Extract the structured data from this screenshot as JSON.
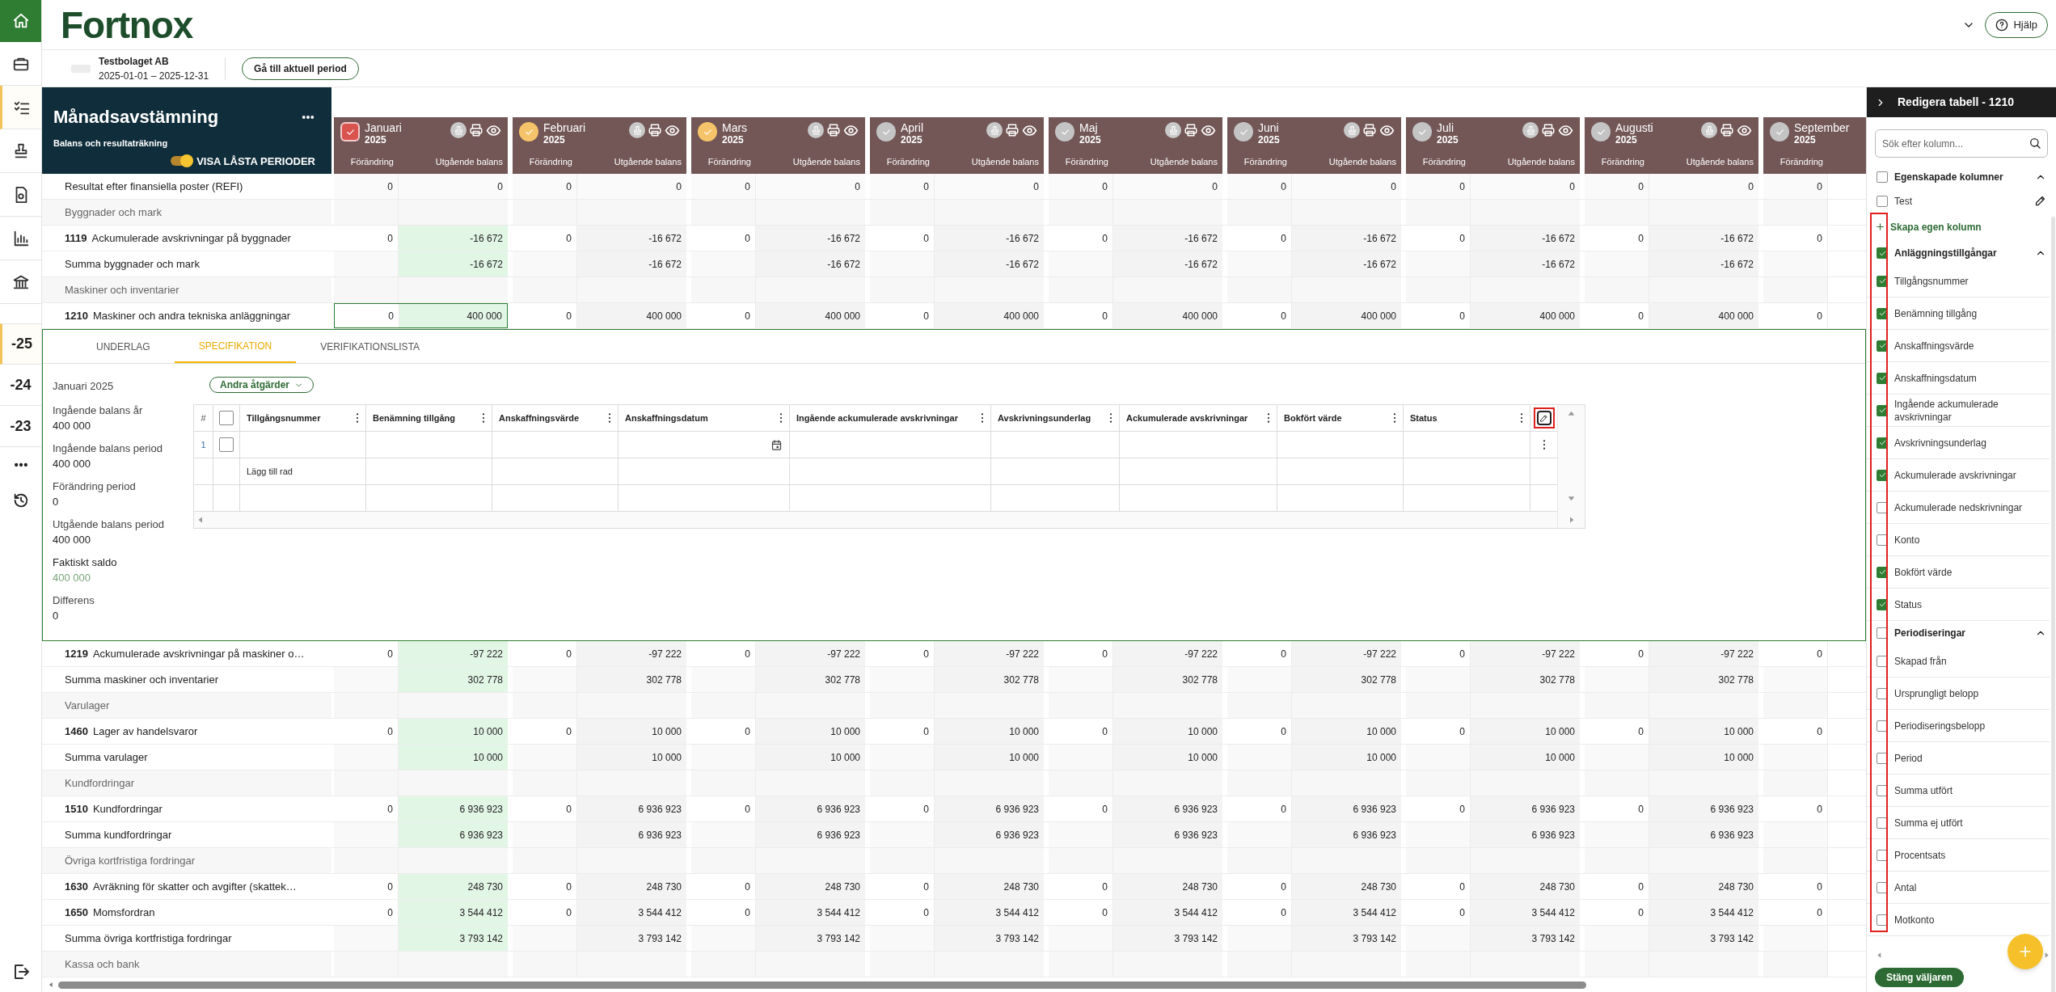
{
  "top_bar": {
    "logo": "Fortnox",
    "help_button": "Hjälp"
  },
  "company_bar": {
    "name": "Testbolaget AB",
    "period": "2025-01-01 – 2025-12-31",
    "button": "Gå till aktuell period"
  },
  "nav": {
    "icons": [
      {
        "selected": false
      },
      {
        "selected": false
      },
      {
        "selected": true
      },
      {
        "selected": false
      },
      {
        "selected": false
      },
      {
        "selected": false
      },
      {
        "selected": false
      }
    ],
    "years": [
      {
        "label": "-25",
        "selected": true
      },
      {
        "label": "-24",
        "selected": false
      },
      {
        "label": "-23",
        "selected": false
      }
    ]
  },
  "page_header": {
    "title": "Månadsavstämning",
    "subtitle": "Balans och resultaträkning",
    "toggle": {
      "label": "VISA LÅSTA PERIODER",
      "on": true
    }
  },
  "months": [
    {
      "name": "Januari",
      "year": "2025",
      "color": "#d9534f",
      "selected": true,
      "columns": [
        "Förändring",
        "Utgående balans"
      ]
    },
    {
      "name": "Februari",
      "year": "2025",
      "color": "#f5c46a",
      "selected": false,
      "columns": [
        "Förändring",
        "Utgående balans"
      ]
    },
    {
      "name": "Mars",
      "year": "2025",
      "color": "#f5c46a",
      "selected": false,
      "columns": [
        "Förändring",
        "Utgående balans"
      ]
    },
    {
      "name": "April",
      "year": "2025",
      "color": "#c4c4c4",
      "selected": false,
      "columns": [
        "Förändring",
        "Utgående balans"
      ]
    },
    {
      "name": "Maj",
      "year": "2025",
      "color": "#c4c4c4",
      "selected": false,
      "columns": [
        "Förändring",
        "Utgående balans"
      ]
    },
    {
      "name": "Juni",
      "year": "2025",
      "color": "#c4c4c4",
      "selected": false,
      "columns": [
        "Förändring",
        "Utgående balans"
      ]
    },
    {
      "name": "Juli",
      "year": "2025",
      "color": "#c4c4c4",
      "selected": false,
      "columns": [
        "Förändring",
        "Utgående balans"
      ]
    },
    {
      "name": "Augusti",
      "year": "2025",
      "color": "#c4c4c4",
      "selected": false,
      "columns": [
        "Förändring",
        "Utgående balans"
      ]
    },
    {
      "name": "September",
      "year": "2025",
      "color": "#c4c4c4",
      "selected": false,
      "columns": [
        "Förändring"
      ]
    }
  ],
  "rows": [
    {
      "kind": "result",
      "label": "Resultat efter finansiella poster (REFI)",
      "expanded": false,
      "change": [
        "0",
        "0",
        "0",
        "0",
        "0",
        "0",
        "0",
        "0",
        "0"
      ],
      "balance": [
        "0",
        "0",
        "0",
        "0",
        "0",
        "0",
        "0",
        "0"
      ]
    },
    {
      "kind": "group",
      "label": "Byggnader och mark",
      "expanded": false
    },
    {
      "kind": "account",
      "account": "1119",
      "label": "Ackumulerade avskrivningar på byggnader",
      "expanded": false,
      "change": [
        "0",
        "0",
        "0",
        "0",
        "0",
        "0",
        "0",
        "0",
        "0"
      ],
      "balance": [
        "-16 672",
        "-16 672",
        "-16 672",
        "-16 672",
        "-16 672",
        "-16 672",
        "-16 672",
        "-16 672"
      ]
    },
    {
      "kind": "sum",
      "label": "Summa byggnader och mark",
      "expanded": false,
      "balance": [
        "-16 672",
        "-16 672",
        "-16 672",
        "-16 672",
        "-16 672",
        "-16 672",
        "-16 672",
        "-16 672"
      ]
    },
    {
      "kind": "group",
      "label": "Maskiner och inventarier",
      "expanded": false
    },
    {
      "kind": "account",
      "account": "1210",
      "label": "Maskiner och andra tekniska anläggningar",
      "expanded": true,
      "change": [
        "0",
        "0",
        "0",
        "0",
        "0",
        "0",
        "0",
        "0",
        "0"
      ],
      "balance": [
        "400 000",
        "400 000",
        "400 000",
        "400 000",
        "400 000",
        "400 000",
        "400 000",
        "400 000"
      ]
    },
    {
      "kind": "account",
      "account": "1219",
      "label": "Ackumulerade avskrivningar på maskiner o…",
      "expanded": false,
      "change": [
        "0",
        "0",
        "0",
        "0",
        "0",
        "0",
        "0",
        "0",
        "0"
      ],
      "balance": [
        "-97 222",
        "-97 222",
        "-97 222",
        "-97 222",
        "-97 222",
        "-97 222",
        "-97 222",
        "-97 222"
      ]
    },
    {
      "kind": "sum",
      "label": "Summa maskiner och inventarier",
      "expanded": false,
      "balance": [
        "302 778",
        "302 778",
        "302 778",
        "302 778",
        "302 778",
        "302 778",
        "302 778",
        "302 778"
      ]
    },
    {
      "kind": "group",
      "label": "Varulager",
      "expanded": false
    },
    {
      "kind": "account",
      "account": "1460",
      "label": "Lager av handelsvaror",
      "expanded": false,
      "change": [
        "0",
        "0",
        "0",
        "0",
        "0",
        "0",
        "0",
        "0",
        "0"
      ],
      "balance": [
        "10 000",
        "10 000",
        "10 000",
        "10 000",
        "10 000",
        "10 000",
        "10 000",
        "10 000"
      ]
    },
    {
      "kind": "sum",
      "label": "Summa varulager",
      "expanded": false,
      "balance": [
        "10 000",
        "10 000",
        "10 000",
        "10 000",
        "10 000",
        "10 000",
        "10 000",
        "10 000"
      ]
    },
    {
      "kind": "group",
      "label": "Kundfordringar",
      "expanded": false
    },
    {
      "kind": "account",
      "account": "1510",
      "label": "Kundfordringar",
      "expanded": false,
      "change": [
        "0",
        "0",
        "0",
        "0",
        "0",
        "0",
        "0",
        "0",
        "0"
      ],
      "balance": [
        "6 936 923",
        "6 936 923",
        "6 936 923",
        "6 936 923",
        "6 936 923",
        "6 936 923",
        "6 936 923",
        "6 936 923"
      ]
    },
    {
      "kind": "sum",
      "label": "Summa kundfordringar",
      "expanded": false,
      "balance": [
        "6 936 923",
        "6 936 923",
        "6 936 923",
        "6 936 923",
        "6 936 923",
        "6 936 923",
        "6 936 923",
        "6 936 923"
      ]
    },
    {
      "kind": "group",
      "label": "Övriga kortfristiga fordringar",
      "expanded": false
    },
    {
      "kind": "account",
      "account": "1630",
      "label": "Avräkning för skatter och avgifter (skattek…",
      "expanded": false,
      "change": [
        "0",
        "0",
        "0",
        "0",
        "0",
        "0",
        "0",
        "0",
        "0"
      ],
      "balance": [
        "248 730",
        "248 730",
        "248 730",
        "248 730",
        "248 730",
        "248 730",
        "248 730",
        "248 730"
      ]
    },
    {
      "kind": "account",
      "account": "1650",
      "label": "Momsfordran",
      "expanded": false,
      "change": [
        "0",
        "0",
        "0",
        "0",
        "0",
        "0",
        "0",
        "0",
        "0"
      ],
      "balance": [
        "3 544 412",
        "3 544 412",
        "3 544 412",
        "3 544 412",
        "3 544 412",
        "3 544 412",
        "3 544 412",
        "3 544 412"
      ]
    },
    {
      "kind": "sum",
      "label": "Summa övriga kortfristiga fordringar",
      "expanded": false,
      "balance": [
        "3 793 142",
        "3 793 142",
        "3 793 142",
        "3 793 142",
        "3 793 142",
        "3 793 142",
        "3 793 142",
        "3 793 142"
      ]
    },
    {
      "kind": "group",
      "label": "Kassa och bank",
      "expanded": false
    }
  ],
  "detail": {
    "tabs": [
      {
        "label": "UNDERLAG",
        "selected": false
      },
      {
        "label": "SPECIFIKATION",
        "selected": true
      },
      {
        "label": "VERIFIKATIONSLISTA",
        "selected": false
      }
    ],
    "period": "Januari 2025",
    "figures": [
      {
        "label": "Ingående balans år",
        "value": "400 000",
        "kind": "plain"
      },
      {
        "label": "Ingående balans period",
        "value": "400 000",
        "kind": "plain"
      },
      {
        "label": "Förändring period",
        "value": "0",
        "kind": "plain"
      },
      {
        "label": "Utgående balans period",
        "value": "400 000",
        "kind": "plain"
      },
      {
        "label": "Faktiskt saldo",
        "value": "400 000",
        "kind": "actual"
      },
      {
        "label": "Differens",
        "value": "0",
        "kind": "plain"
      }
    ],
    "actions_button": "Andra åtgärder",
    "spec_table": {
      "index_header": "#",
      "all_checked": false,
      "edit_highlighted": true,
      "columns": [
        {
          "label": "Tillgångsnummer",
          "kind": "text"
        },
        {
          "label": "Benämning tillgång",
          "kind": "text"
        },
        {
          "label": "Anskaffningsvärde",
          "kind": "text"
        },
        {
          "label": "Anskaffningsdatum",
          "kind": "date"
        },
        {
          "label": "Ingående ackumulerade avskrivningar",
          "kind": "text"
        },
        {
          "label": "Avskrivningsunderlag",
          "kind": "text"
        },
        {
          "label": "Ackumulerade avskrivningar",
          "kind": "text"
        },
        {
          "label": "Bokfört värde",
          "kind": "text"
        },
        {
          "label": "Status",
          "kind": "text"
        }
      ],
      "rows": [
        {
          "kind": "entry",
          "number": "1",
          "checked": false
        },
        {
          "kind": "add",
          "label": "Lägg till rad"
        }
      ]
    }
  },
  "column_picker": {
    "title": "Redigera tabell - 1210",
    "search_placeholder": "Sök efter kolumn...",
    "checkboxes_highlighted": true,
    "close_button": "Stäng väljaren",
    "groups": [
      {
        "label": "Egenskapade kolumner",
        "checked": false,
        "expanded": true,
        "add_link": "Skapa egen kolumn",
        "items": [
          {
            "label": "Test",
            "checked": false,
            "kind": "custom"
          }
        ]
      },
      {
        "label": "Anläggningstillgångar",
        "checked": true,
        "expanded": true,
        "items": [
          {
            "label": "Tillgångsnummer",
            "checked": true,
            "kind": "column"
          },
          {
            "label": "Benämning tillgång",
            "checked": true,
            "kind": "column"
          },
          {
            "label": "Anskaffningsvärde",
            "checked": true,
            "kind": "column"
          },
          {
            "label": "Anskaffningsdatum",
            "checked": true,
            "kind": "column"
          },
          {
            "label": "Ingående ackumulerade avskrivningar",
            "checked": true,
            "kind": "column"
          },
          {
            "label": "Avskrivningsunderlag",
            "checked": true,
            "kind": "column"
          },
          {
            "label": "Ackumulerade avskrivningar",
            "checked": true,
            "kind": "column"
          },
          {
            "label": "Ackumulerade nedskrivningar",
            "checked": false,
            "kind": "column"
          },
          {
            "label": "Konto",
            "checked": false,
            "kind": "column"
          },
          {
            "label": "Bokfört värde",
            "checked": true,
            "kind": "column"
          },
          {
            "label": "Status",
            "checked": true,
            "kind": "column"
          }
        ]
      },
      {
        "label": "Periodiseringar",
        "checked": false,
        "expanded": true,
        "items": [
          {
            "label": "Skapad från",
            "checked": false,
            "kind": "column"
          },
          {
            "label": "Ursprungligt belopp",
            "checked": false,
            "kind": "column"
          },
          {
            "label": "Periodiseringsbelopp",
            "checked": false,
            "kind": "column"
          },
          {
            "label": "Period",
            "checked": false,
            "kind": "column"
          },
          {
            "label": "Summa utfört",
            "checked": false,
            "kind": "column"
          },
          {
            "label": "Summa ej utfört",
            "checked": false,
            "kind": "column"
          },
          {
            "label": "Procentsats",
            "checked": false,
            "kind": "column"
          },
          {
            "label": "Antal",
            "checked": false,
            "kind": "column"
          },
          {
            "label": "Motkonto",
            "checked": false,
            "kind": "column"
          }
        ]
      }
    ]
  }
}
